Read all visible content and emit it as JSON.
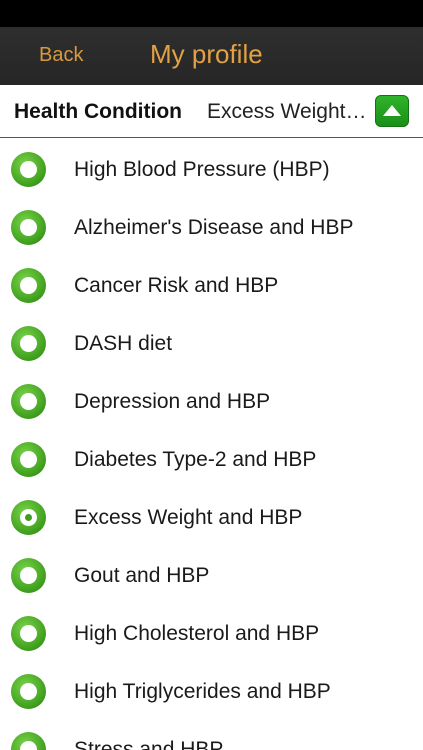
{
  "nav": {
    "back_label": "Back",
    "title": "My profile"
  },
  "header": {
    "label": "Health Condition",
    "value": "Excess Weight and HBP"
  },
  "colors": {
    "nav_accent": "#e2a144",
    "radio_green": "#3d9e1c",
    "toggle_green": "#1a8f18"
  },
  "conditions": [
    {
      "label": "High Blood Pressure (HBP)",
      "selected": false
    },
    {
      "label": "Alzheimer's Disease and HBP",
      "selected": false
    },
    {
      "label": "Cancer Risk and HBP",
      "selected": false
    },
    {
      "label": "DASH diet",
      "selected": false
    },
    {
      "label": "Depression and HBP",
      "selected": false
    },
    {
      "label": "Diabetes Type-2 and HBP",
      "selected": false
    },
    {
      "label": "Excess Weight and HBP",
      "selected": true
    },
    {
      "label": "Gout and HBP",
      "selected": false
    },
    {
      "label": "High Cholesterol and HBP",
      "selected": false
    },
    {
      "label": "High Triglycerides and HBP",
      "selected": false
    },
    {
      "label": "Stress and HBP",
      "selected": false
    }
  ]
}
